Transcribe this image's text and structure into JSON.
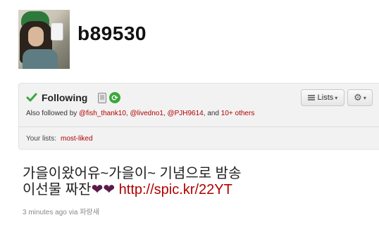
{
  "profile": {
    "screen_name": "b89530"
  },
  "follow_box": {
    "following_label": "Following",
    "also_followed_prefix": "Also followed by",
    "users": [
      "@fish_thank10",
      "@livedno1",
      "@PJH9614"
    ],
    "and_text": "and",
    "others": "10+ others",
    "lists_button": "Lists",
    "your_lists_label": "Your lists:",
    "your_lists_item": "most-liked"
  },
  "tweet": {
    "line1": "가을이왔어유~가을이~ 기념으로 밤송",
    "line2": "이선물 짜잔",
    "hearts": "❤❤",
    "link": "http://spic.kr/22YT",
    "time": "3 minutes ago",
    "via": "via",
    "client": "파랑새"
  },
  "colors": {
    "link": "#b10000",
    "check": "#3aa83a",
    "box_bg": "#f2f2f2"
  }
}
